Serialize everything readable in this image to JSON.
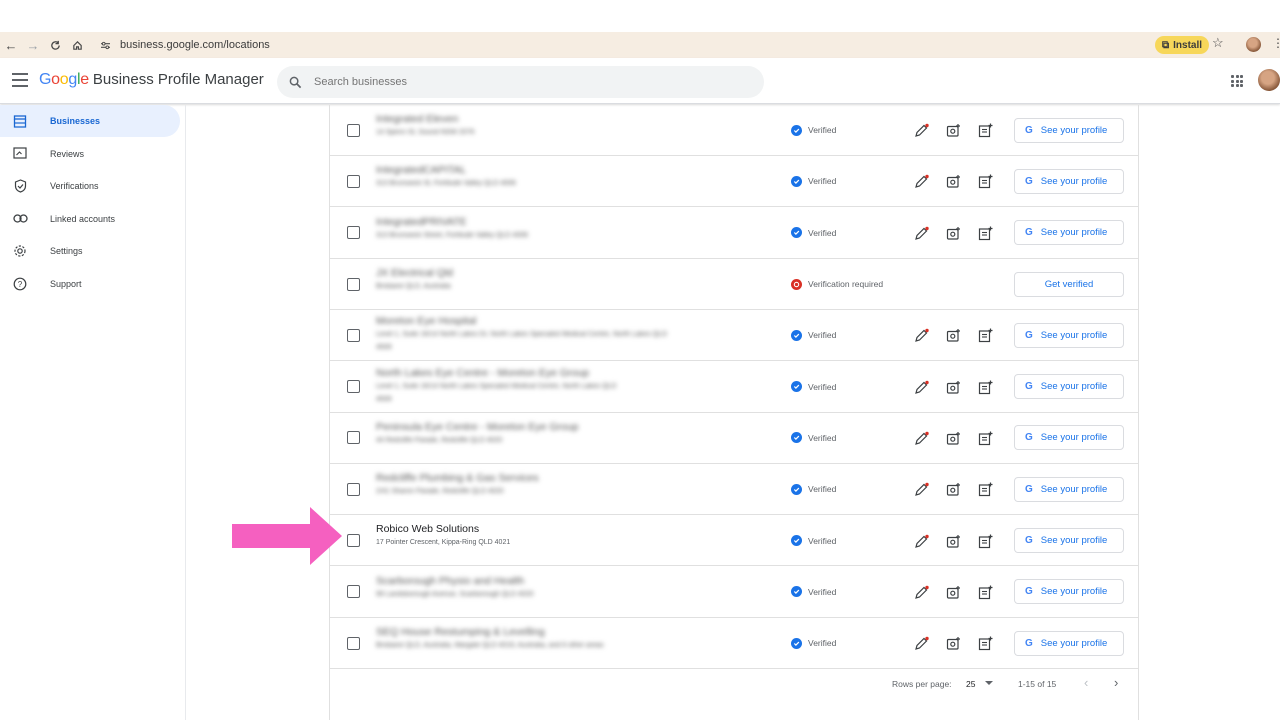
{
  "browser": {
    "url": "business.google.com/locations",
    "install_label": "Install"
  },
  "app": {
    "logo_google": [
      "G",
      "o",
      "o",
      "g",
      "l",
      "e"
    ],
    "logo_colors": [
      "#4285f4",
      "#ea4335",
      "#fbbc05",
      "#4285f4",
      "#34a853",
      "#ea4335"
    ],
    "title_rest": "Business Profile Manager",
    "search_placeholder": "Search businesses"
  },
  "sidebar": {
    "items": [
      {
        "label": "Businesses",
        "icon": "storefront-icon",
        "active": true
      },
      {
        "label": "Reviews",
        "icon": "reviews-icon",
        "active": false
      },
      {
        "label": "Verifications",
        "icon": "shield-check-icon",
        "active": false
      },
      {
        "label": "Linked accounts",
        "icon": "link-icon",
        "active": false
      },
      {
        "label": "Settings",
        "icon": "gear-icon",
        "active": false
      },
      {
        "label": "Support",
        "icon": "help-icon",
        "active": false
      }
    ]
  },
  "table": {
    "rows": [
      {
        "name": "Integrated Eleven",
        "address": "14 Spenn St, Sound NSW 2076",
        "blurred": true,
        "status": "Verified",
        "verified": true
      },
      {
        "name": "IntegratedCAPITAL",
        "address": "313 Brunswick St, Fortitude Valley QLD 4006",
        "blurred": true,
        "status": "Verified",
        "verified": true
      },
      {
        "name": "IntegratedPRIVATE",
        "address": "313 Brunswick Street, Fortitude Valley QLD 4006",
        "blurred": true,
        "status": "Verified",
        "verified": true
      },
      {
        "name": "JX Electrical Qld",
        "address": "Brisbane QLD, Australia",
        "blurred": true,
        "status": "Verification required",
        "verified": false
      },
      {
        "name": "Moreton Eye Hospital",
        "address": "Level 1, Suite 16/14 North Lakes Dr, North Lakes Specialist Medical Centre, North Lakes QLD",
        "address2": "4509",
        "blurred": true,
        "status": "Verified",
        "verified": true
      },
      {
        "name": "North Lakes Eye Centre - Moreton Eye Group",
        "address": "Level 1, Suite 16/14 North Lakes Specialist Medical Centre, North Lakes QLD",
        "address2": "4509",
        "blurred": true,
        "status": "Verified",
        "verified": true
      },
      {
        "name": "Peninsula Eye Centre - Moreton Eye Group",
        "address": "44 Redcliffe Parade, Redcliffe QLD 4020",
        "blurred": true,
        "status": "Verified",
        "verified": true
      },
      {
        "name": "Redcliffe Plumbing & Gas Services",
        "address": "2/41 Sharon Parade, Redcliffe QLD 4020",
        "blurred": true,
        "status": "Verified",
        "verified": true
      },
      {
        "name": "Robico Web Solutions",
        "address": "17 Pointer Crescent, Kippa-Ring QLD 4021",
        "blurred": false,
        "status": "Verified",
        "verified": true
      },
      {
        "name": "Scarborough Physio and Health",
        "address": "99 Landsborough Avenue, Scarborough QLD 4020",
        "blurred": true,
        "status": "Verified",
        "verified": true
      },
      {
        "name": "SEQ House Restumping & Levelling",
        "address": "Brisbane QLD, Australia, Margate QLD 4019, Australia, and 6 other areas",
        "blurred": true,
        "status": "Verified",
        "verified": true
      }
    ],
    "profile_button_label": "See your profile",
    "get_verified_label": "Get verified",
    "profile_g": "G"
  },
  "footer": {
    "rows_per_page_label": "Rows per page:",
    "rows_per_page_value": "25",
    "range": "1-15 of 15"
  },
  "colors": {
    "accent": "#1a73e8",
    "active_bg": "#e8f0fe",
    "error": "#d93025",
    "arrow": "#f560c0"
  }
}
